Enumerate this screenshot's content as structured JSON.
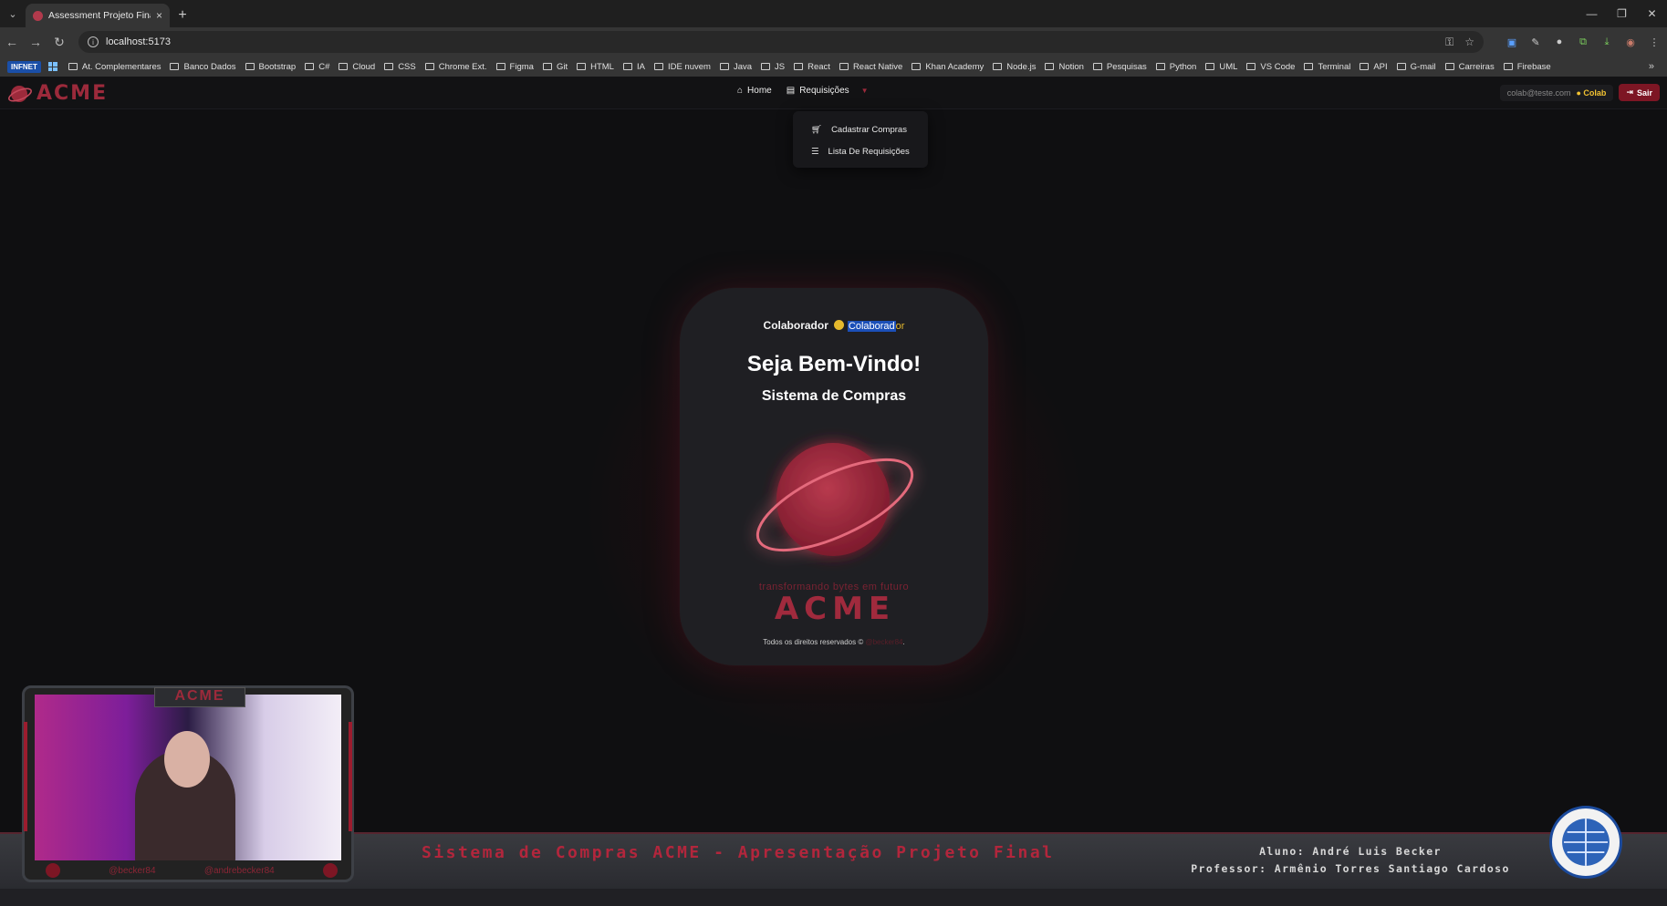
{
  "browser": {
    "tab_title": "Assessment Projeto Final - Andr",
    "url": "localhost:5173",
    "bookmarks": [
      "At. Complementares",
      "Banco Dados",
      "Bootstrap",
      "C#",
      "Cloud",
      "CSS",
      "Chrome Ext.",
      "Figma",
      "Git",
      "HTML",
      "IA",
      "IDE nuvem",
      "Java",
      "JS",
      "React",
      "React Native",
      "Khan Academy",
      "Node.js",
      "Notion",
      "Pesquisas",
      "Python",
      "UML",
      "VS Code",
      "Terminal",
      "API",
      "G-mail",
      "Carreiras",
      "Firebase"
    ],
    "infnet_label": "INFNET"
  },
  "app": {
    "logo_text": "ACME",
    "nav": {
      "home": "Home",
      "requisicoes": "Requisições"
    },
    "dropdown": {
      "cadastrar": "Cadastrar Compras",
      "lista": "Lista De Requisições"
    },
    "user": {
      "email": "colab@teste.com",
      "role": "Colab",
      "logout": "Sair"
    }
  },
  "card": {
    "role_label": "Colaborador",
    "role_badge_selected": "Colaborad",
    "role_badge_rest": "or",
    "welcome": "Seja Bem-Vindo!",
    "subtitle": "Sistema de Compras",
    "brand": "ACME",
    "tagline": "transformando bytes em futuro",
    "footer_text": "Todos os direitos reservados ©",
    "footer_link": "@becker84",
    "footer_end": "."
  },
  "overlay": {
    "title": "Sistema de Compras ACME - Apresentação Projeto Final",
    "student": "Aluno: André Luis Becker",
    "professor": "Professor: Armênio Torres Santiago Cardoso",
    "webcam_badge": "ACME",
    "handle_left": "@becker84",
    "handle_right": "@andrebecker84"
  },
  "colors": {
    "accent": "#9c2a3b",
    "accent_dark": "#7d1624",
    "role_gold": "#e6b92d"
  }
}
